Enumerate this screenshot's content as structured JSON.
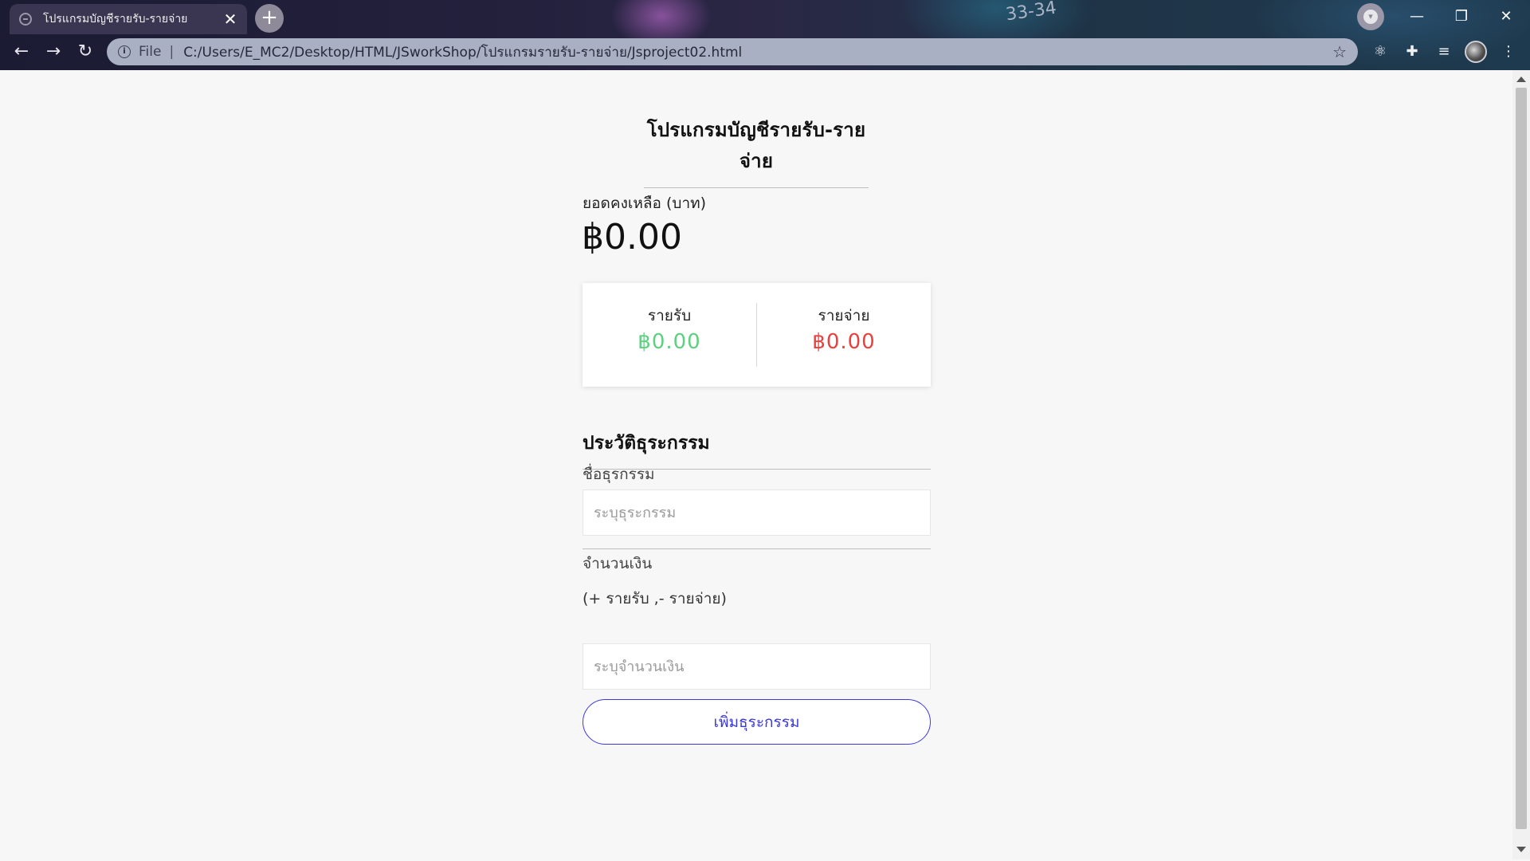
{
  "browser": {
    "tab_title": "โปรแกรมบัญชีรายรับ-รายจ่าย",
    "tab_close": "✕",
    "new_tab": "+",
    "decor_text": "33-34",
    "profile_chevron": "▾",
    "window_controls": {
      "minimize": "—",
      "maximize": "❐",
      "close": "✕"
    },
    "nav": {
      "back": "←",
      "forward": "→",
      "reload": "↻"
    },
    "address": {
      "info_icon": "i",
      "scheme": "File",
      "separator": "|",
      "url": "C:/Users/E_MC2/Desktop/HTML/JSworkShop/โปรแกรมรายรับ-รายจ่าย/Jsproject02.html",
      "bookmark_icon": "☆"
    },
    "toolbar": {
      "react_icon": "⚛",
      "extensions_icon": "✚",
      "reading_list_icon": "≡",
      "menu_icon": "⋮"
    }
  },
  "page": {
    "title": "โปรแกรมบัญชีรายรับ-รายจ่าย",
    "balance": {
      "label": "ยอดคงเหลือ (บาท)",
      "value": "฿0.00"
    },
    "summary": {
      "income_label": "รายรับ",
      "income_value": "฿0.00",
      "expense_label": "รายจ่าย",
      "expense_value": "฿0.00"
    },
    "history_heading": "ประวัติธุระกรรม",
    "add_heading": "เพิ่มธุระกรรม",
    "form": {
      "name_label": "ชื่อธุรกรรม",
      "name_placeholder": "ระบุธุระกรรม",
      "amount_label": "จำนวนเงิน",
      "amount_hint": "(+ รายรับ ,- รายจ่าย)",
      "amount_placeholder": "ระบุจำนวนเงิน",
      "submit_label": "เพิ่มธุระกรรม"
    }
  },
  "colors": {
    "income": "#5fcf80",
    "expense": "#e8413f",
    "accent": "#3a38d6"
  }
}
